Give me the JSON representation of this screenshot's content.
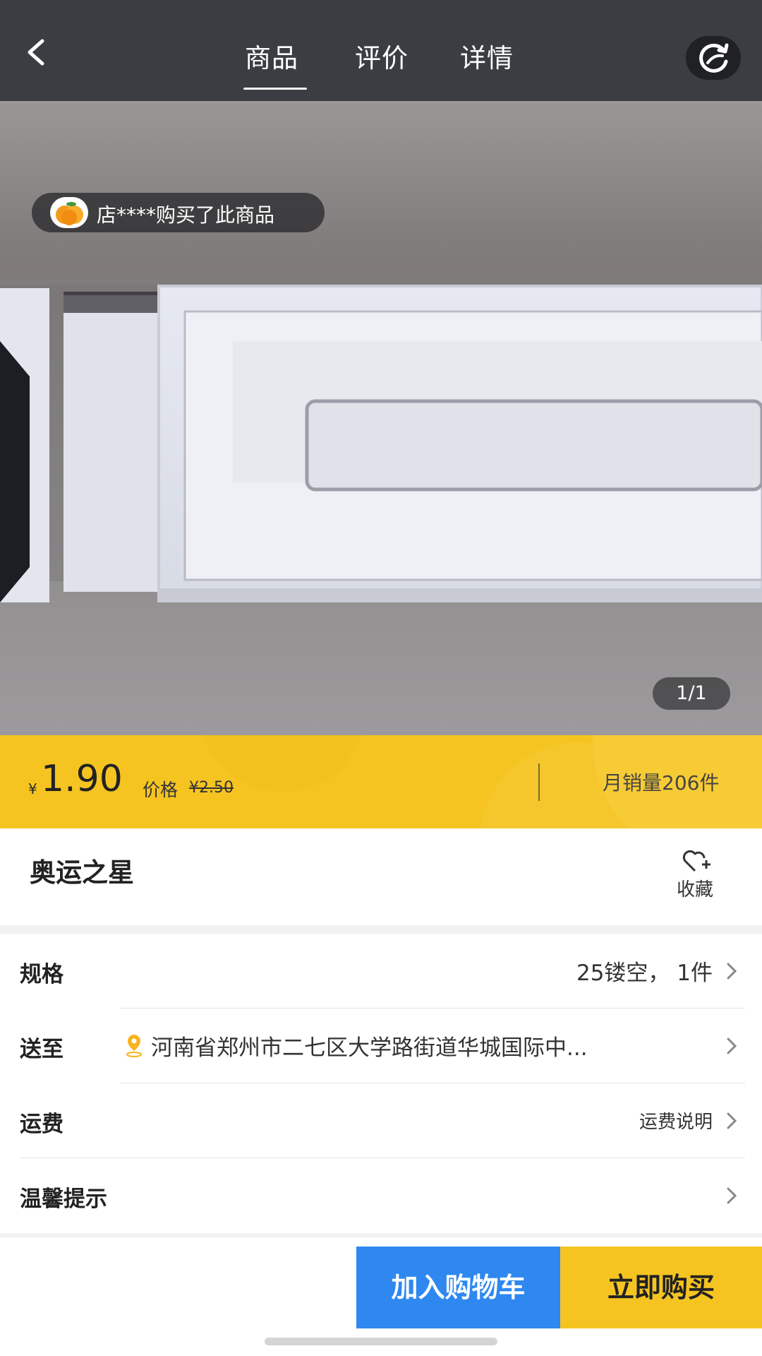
{
  "header": {
    "tabs": [
      {
        "label": "商品",
        "active": true
      },
      {
        "label": "评价",
        "active": false
      },
      {
        "label": "详情",
        "active": false
      }
    ],
    "back_icon": "chevron-left-icon",
    "share_icon": "refresh-share-icon"
  },
  "gallery": {
    "buyer_notice": "店****购买了此商品",
    "counter": "1/1"
  },
  "price": {
    "currency": "¥",
    "current": "1.90",
    "original_label": "价格",
    "original_value": "¥2.50",
    "monthly_sales": "月销量206件"
  },
  "product": {
    "title": "奥运之星",
    "favorite_label": "收藏"
  },
  "options": {
    "spec_label": "规格",
    "spec_value": "25镂空， 1件",
    "ship_to_label": "送至",
    "ship_to_value": "河南省郑州市二七区大学路街道华城国际中...",
    "freight_label": "运费",
    "freight_value": "运费说明",
    "tips_label": "温馨提示"
  },
  "actions": {
    "add_to_cart": "加入购物车",
    "buy_now": "立即购买"
  },
  "colors": {
    "header_bg": "#3a3d42",
    "price_bar": "#f5c421",
    "cart_button": "#2e88f0",
    "buy_button": "#f5c421"
  }
}
